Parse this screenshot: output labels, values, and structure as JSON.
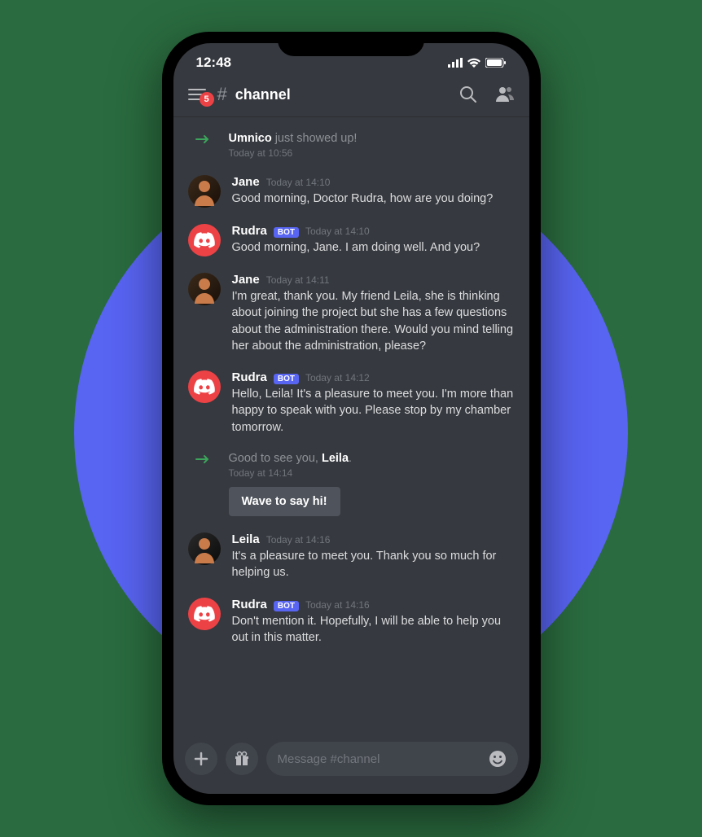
{
  "status_bar": {
    "time": "12:48"
  },
  "header": {
    "badge_count": "5",
    "channel_name": "channel"
  },
  "messages": [
    {
      "type": "system",
      "highlight": "Umnico",
      "text": " just showed up!",
      "timestamp": "Today at 10:56"
    },
    {
      "type": "msg",
      "author": "Jane",
      "avatar": "jane",
      "timestamp": "Today at 14:10",
      "text": "Good morning, Doctor Rudra, how are you doing?"
    },
    {
      "type": "msg",
      "author": "Rudra",
      "avatar": "discord",
      "bot": true,
      "timestamp": "Today at 14:10",
      "text": "Good morning, Jane. I am doing well. And you?"
    },
    {
      "type": "msg",
      "author": "Jane",
      "avatar": "jane",
      "timestamp": "Today at 14:11",
      "text": "I'm great, thank you. My friend Leila, she is thinking about joining the project but she has a few questions about the administration there. Would you mind telling her about the administration, please?"
    },
    {
      "type": "msg",
      "author": "Rudra",
      "avatar": "discord",
      "bot": true,
      "timestamp": "Today at 14:12",
      "text": "Hello, Leila! It's a pleasure to meet you. I'm more than happy to speak with you. Please stop by my chamber tomorrow."
    },
    {
      "type": "system",
      "text_before": "Good to see you,  ",
      "highlight": "Leila",
      "text_after": ".",
      "timestamp": "Today at 14:14",
      "button": "Wave to say hi!"
    },
    {
      "type": "msg",
      "author": "Leila",
      "avatar": "leila",
      "timestamp": "Today at 14:16",
      "text": "It's a pleasure to meet you. Thank you so much for helping us."
    },
    {
      "type": "msg",
      "author": "Rudra",
      "avatar": "discord",
      "bot": true,
      "timestamp": "Today at 14:16",
      "text": "Don't mention it. Hopefully, I will be able to help you out in this matter."
    }
  ],
  "bot_label": "BOT",
  "composer": {
    "placeholder": "Message #channel"
  }
}
